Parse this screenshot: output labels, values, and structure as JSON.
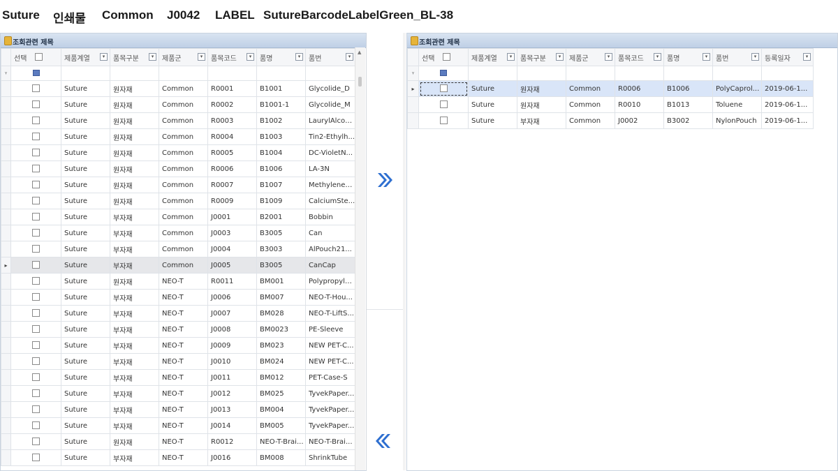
{
  "header": {
    "parts": [
      "Suture",
      "인쇄물",
      "Common",
      "J0042",
      "LABEL",
      "SutureBarcodeLabelGreen_BL-38"
    ]
  },
  "left_panel": {
    "title": "조회관련 제목",
    "columns": [
      "선택",
      "제품계열",
      "품목구분",
      "제품군",
      "품목코드",
      "품명",
      "품번"
    ],
    "rows": [
      [
        "Suture",
        "원자재",
        "Common",
        "R0001",
        "B1001",
        "Glycolide_D"
      ],
      [
        "Suture",
        "원자재",
        "Common",
        "R0002",
        "B1001-1",
        "Glycolide_M"
      ],
      [
        "Suture",
        "원자재",
        "Common",
        "R0003",
        "B1002",
        "LaurylAlcohol"
      ],
      [
        "Suture",
        "원자재",
        "Common",
        "R0004",
        "B1003",
        "Tin2-Ethylh..."
      ],
      [
        "Suture",
        "원자재",
        "Common",
        "R0005",
        "B1004",
        "DC-VioletN..."
      ],
      [
        "Suture",
        "원자재",
        "Common",
        "R0006",
        "B1006",
        "LA-3N"
      ],
      [
        "Suture",
        "원자재",
        "Common",
        "R0007",
        "B1007",
        "MethyleneC..."
      ],
      [
        "Suture",
        "원자재",
        "Common",
        "R0009",
        "B1009",
        "CalciumSte..."
      ],
      [
        "Suture",
        "부자재",
        "Common",
        "J0001",
        "B2001",
        "Bobbin"
      ],
      [
        "Suture",
        "부자재",
        "Common",
        "J0003",
        "B3005",
        "Can"
      ],
      [
        "Suture",
        "부자재",
        "Common",
        "J0004",
        "B3003",
        "AlPouch21..."
      ],
      [
        "Suture",
        "부자재",
        "Common",
        "J0005",
        "B3005",
        "CanCap"
      ],
      [
        "Suture",
        "원자재",
        "NEO-T",
        "R0011",
        "BM001",
        "Polypropyle..."
      ],
      [
        "Suture",
        "부자재",
        "NEO-T",
        "J0006",
        "BM007",
        "NEO-T-Hou..."
      ],
      [
        "Suture",
        "부자재",
        "NEO-T",
        "J0007",
        "BM028",
        "NEO-T-LiftS..."
      ],
      [
        "Suture",
        "부자재",
        "NEO-T",
        "J0008",
        "BM0023",
        "PE-Sleeve"
      ],
      [
        "Suture",
        "부자재",
        "NEO-T",
        "J0009",
        "BM023",
        "NEW PET-C..."
      ],
      [
        "Suture",
        "부자재",
        "NEO-T",
        "J0010",
        "BM024",
        "NEW PET-C..."
      ],
      [
        "Suture",
        "부자재",
        "NEO-T",
        "J0011",
        "BM012",
        "PET-Case-S"
      ],
      [
        "Suture",
        "부자재",
        "NEO-T",
        "J0012",
        "BM025",
        "TyvekPaper..."
      ],
      [
        "Suture",
        "부자재",
        "NEO-T",
        "J0013",
        "BM004",
        "TyvekPaper..."
      ],
      [
        "Suture",
        "부자재",
        "NEO-T",
        "J0014",
        "BM005",
        "TyvekPaper..."
      ],
      [
        "Suture",
        "원자재",
        "NEO-T",
        "R0012",
        "NEO-T-Brai...",
        "NEO-T-Brai..."
      ],
      [
        "Suture",
        "부자재",
        "NEO-T",
        "J0016",
        "BM008",
        "ShrinkTube"
      ]
    ],
    "current_row_index": 11
  },
  "right_panel": {
    "title": "조회관련 제목",
    "columns": [
      "선택",
      "제품계열",
      "품목구분",
      "제품군",
      "품목코드",
      "품명",
      "품번",
      "등록일자"
    ],
    "rows": [
      [
        "Suture",
        "원자재",
        "Common",
        "R0006",
        "B1006",
        "PolyCaprol...",
        "2019-06-1..."
      ],
      [
        "Suture",
        "원자재",
        "Common",
        "R0010",
        "B1013",
        "Toluene",
        "2019-06-1..."
      ],
      [
        "Suture",
        "부자재",
        "Common",
        "J0002",
        "B3002",
        "NylonPouch",
        "2019-06-1..."
      ]
    ],
    "current_row_index": 0
  },
  "buttons": {
    "move_right_icon": "double-chevron-right-icon",
    "move_left_icon": "double-chevron-left-icon"
  },
  "colors": {
    "panel_header": "#bfd0e6",
    "selected_row": "#d9e5f8",
    "current_row": "#e6e7ea",
    "arrow_button": "#2e6fd0"
  }
}
